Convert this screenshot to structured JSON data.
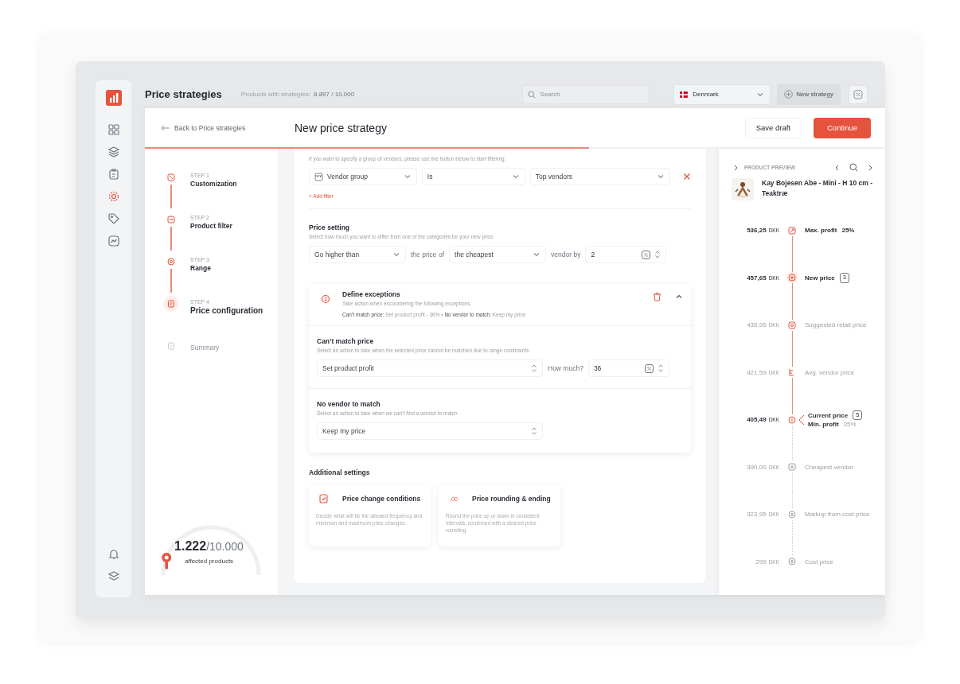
{
  "sidebar": {
    "items": [
      {
        "selected": false
      },
      {
        "selected": false
      },
      {
        "selected": false
      },
      {
        "selected": true
      },
      {
        "selected": false
      },
      {
        "selected": false
      }
    ]
  },
  "topbar": {
    "title": "Price strategies",
    "stats_label": "Products with strategies:",
    "stats_value": "8.897 / 10.000",
    "search": {
      "placeholder": "Search"
    },
    "country": "Denmark",
    "new_button": "New strategy"
  },
  "modal": {
    "back": "Back to Price strategies",
    "title": "New price strategy",
    "save": "Save draft",
    "continue": "Continue",
    "progress": {
      "level": 0.6
    }
  },
  "steps": [
    {
      "step": "STEP 1",
      "title": "Customization",
      "completed": true,
      "current": false
    },
    {
      "step": "STEP 2",
      "title": "Product filter",
      "completed": true,
      "current": false
    },
    {
      "step": "STEP 3",
      "title": "Range",
      "completed": true,
      "current": false
    },
    {
      "step": "STEP 4",
      "title": "Price configuration",
      "completed": true,
      "current": true
    },
    {
      "title": "Summary",
      "completed": false,
      "current": false
    }
  ],
  "affected": {
    "value": "1.222",
    "total": "/10.000",
    "label": "affected products",
    "level": 0.12
  },
  "vendor_filter": {
    "hint": "If you want to specify a group of vendors, please use the button below to start filtering.",
    "field": "Vendor group",
    "operator": "Is",
    "value": "Top vendors",
    "add": "+ Add filter"
  },
  "price_setting": {
    "title": "Price setting",
    "hint": "Select how much you want to differ from one of the categories for your new price.",
    "direction": "Go higher than",
    "text_1": "the price of",
    "target": "the cheapest",
    "text_2": "vendor by",
    "amount": "2"
  },
  "exceptions": {
    "title": "Define exceptions",
    "hint": "Take action when encountering the following exceptions.",
    "summary": "**Can’t match price:** Set product profit - 36%  •  **No vendor to match:** Keep my price",
    "expanded": true,
    "sections": [
      {
        "kind": "amount",
        "title": "Can’t match price",
        "hint": "Select an action to take when the selected price cannot be matched due to range constraints.",
        "action": "Set product profit",
        "amount_label": "How much?",
        "amount": "36"
      },
      {
        "kind": "plain",
        "title": "No vendor to match",
        "hint": "Select an action to take when we can’t find a vendor to match.",
        "action": "Keep my price"
      }
    ]
  },
  "additional": {
    "title": "Additional settings",
    "cards": [
      {
        "kind": "conditions",
        "title": "Price change conditions",
        "text": "Decide what will be the allowed frequency and minimum and maximum price changes."
      },
      {
        "kind": "rounding",
        "icon_text": ",00",
        "title": "Price rounding & ending",
        "text": "Round the price up or down in consistent intervals, combined with a desired price rounding."
      }
    ]
  },
  "preview": {
    "title": "PRODUCT PREVIEW",
    "product": "Kay Bojesen Abe - Mini - H 10 cm - Teaktræ",
    "points": [
      {
        "price": "536,25",
        "currency": "DKK",
        "label": "Max. profit",
        "extra": "25%",
        "emphasis": true,
        "highlighted": true
      },
      {
        "price": "457,65",
        "currency": "DKK",
        "label": "New price",
        "badge": "3",
        "emphasis": true,
        "highlighted": true,
        "current": true
      },
      {
        "price": "435,95",
        "currency": "DKK",
        "label": "Suggested retail price",
        "emphasis": false,
        "highlighted": true
      },
      {
        "price": "421,59",
        "currency": "DKK",
        "label": "Avg. vendor price",
        "emphasis": false,
        "highlighted": true
      },
      {
        "price": "405,49",
        "currency": "DKK",
        "label": "Current price",
        "badge": "5",
        "sub_label": "Min. profit",
        "sub_extra": "25%",
        "emphasis": true,
        "highlighted": true
      },
      {
        "price": "390,00",
        "currency": "DKK",
        "label": "Cheapest vendor",
        "emphasis": false,
        "highlighted": false
      },
      {
        "price": "323,95",
        "currency": "DKK",
        "label": "Markup from cost price",
        "emphasis": false,
        "highlighted": false
      },
      {
        "price": "299",
        "currency": "DKK",
        "label": "Cost price",
        "emphasis": false,
        "highlighted": false
      }
    ]
  }
}
